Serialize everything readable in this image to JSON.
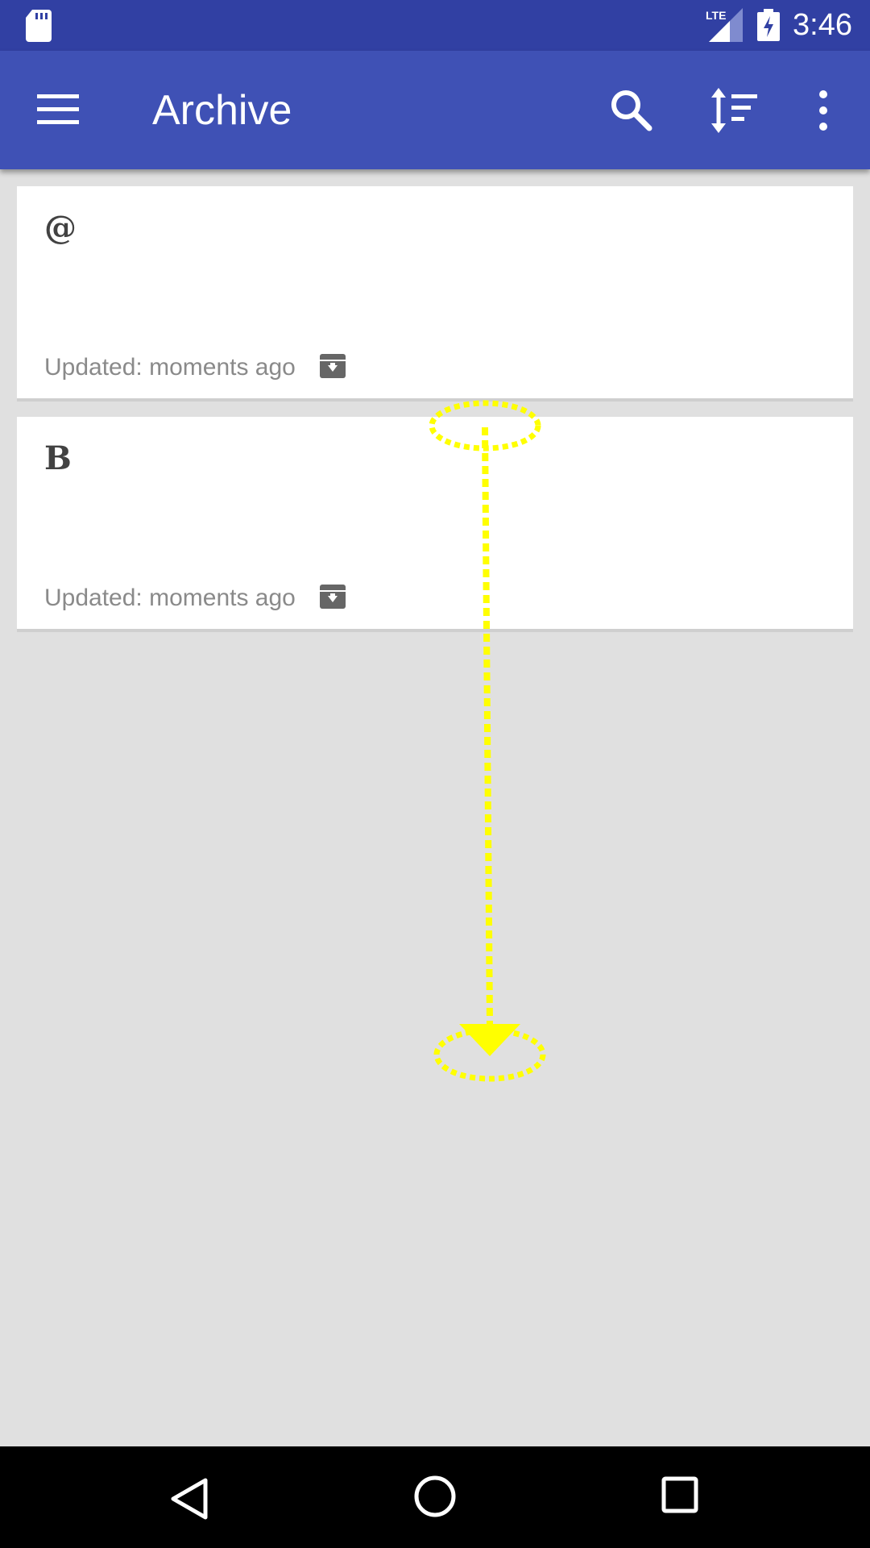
{
  "status_bar": {
    "time": "3:46",
    "network": "LTE",
    "icons": [
      "sd-card-icon",
      "lte-signal-icon",
      "battery-charging-icon"
    ]
  },
  "app_bar": {
    "title": "Archive",
    "icons": [
      "menu-icon",
      "search-icon",
      "sort-icon",
      "more-vert-icon"
    ],
    "color": "#3f51b5",
    "status_color": "#3140a3"
  },
  "notes": [
    {
      "title": "@",
      "updated": "Updated: moments ago",
      "icon": "unarchive-icon"
    },
    {
      "title": "B",
      "updated": "Updated: moments ago",
      "icon": "unarchive-icon"
    }
  ],
  "gesture_overlay": {
    "type": "swipe-down",
    "color": "#ffff00"
  },
  "nav_bar": {
    "icons": [
      "back-icon",
      "home-icon",
      "recents-icon"
    ]
  }
}
